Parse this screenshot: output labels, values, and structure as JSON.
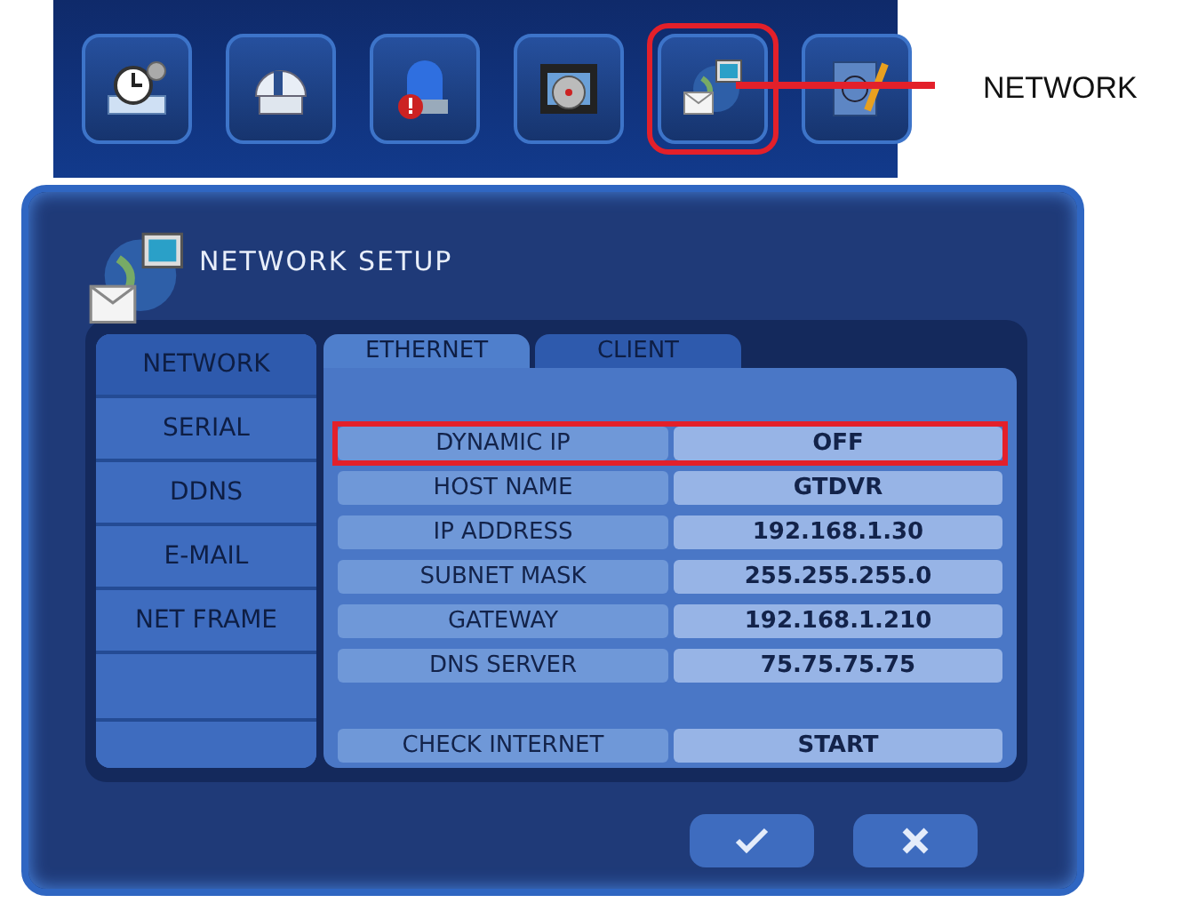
{
  "toolbar": {
    "items": [
      {
        "kind": "schedule",
        "selected": false
      },
      {
        "kind": "dome",
        "selected": false
      },
      {
        "kind": "alarm",
        "selected": false
      },
      {
        "kind": "film",
        "selected": false
      },
      {
        "kind": "network",
        "selected": true
      },
      {
        "kind": "notebook",
        "selected": false
      }
    ]
  },
  "callout": {
    "label": "NETWORK"
  },
  "dialog": {
    "title": "NETWORK SETUP",
    "menu": [
      {
        "label": "NETWORK",
        "selected": true
      },
      {
        "label": "SERIAL",
        "selected": false
      },
      {
        "label": "DDNS",
        "selected": false
      },
      {
        "label": "E-MAIL",
        "selected": false
      },
      {
        "label": "NET FRAME",
        "selected": false
      }
    ],
    "tabs": [
      {
        "label": "ETHERNET",
        "selected": true
      },
      {
        "label": "CLIENT",
        "selected": false
      }
    ],
    "rows": [
      {
        "kind": "field",
        "label": "DYNAMIC IP",
        "value": "OFF",
        "highlighted": true
      },
      {
        "kind": "field",
        "label": "HOST NAME",
        "value": "GTDVR",
        "highlighted": false
      },
      {
        "kind": "field",
        "label": "IP ADDRESS",
        "value": "192.168.1.30",
        "highlighted": false
      },
      {
        "kind": "field",
        "label": "SUBNET MASK",
        "value": "255.255.255.0",
        "highlighted": false
      },
      {
        "kind": "field",
        "label": "GATEWAY",
        "value": "192.168.1.210",
        "highlighted": false
      },
      {
        "kind": "field",
        "label": "DNS SERVER",
        "value": "75.75.75.75",
        "highlighted": false
      },
      {
        "kind": "action",
        "label": "CHECK INTERNET",
        "value": "START",
        "highlighted": false
      }
    ],
    "actions": [
      {
        "kind": "ok"
      },
      {
        "kind": "cancel"
      }
    ]
  }
}
